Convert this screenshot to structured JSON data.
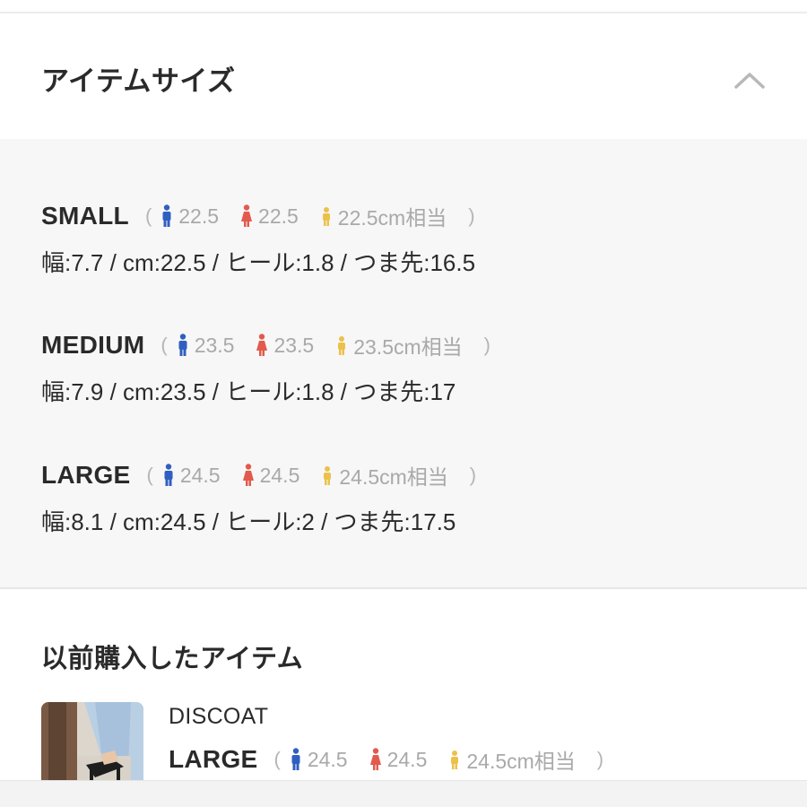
{
  "header": {
    "title": "アイテムサイズ",
    "collapse_icon": "chevron-up-icon"
  },
  "equivalence_labels": {
    "open_paren": "(",
    "close_paren": ")"
  },
  "icons": {
    "men": {
      "name": "man-icon",
      "color": "#2f5fbf"
    },
    "women": {
      "name": "woman-icon",
      "color": "#e25a4e"
    },
    "kids": {
      "name": "child-icon",
      "color": "#ecc14a"
    }
  },
  "sizes": [
    {
      "name": "SMALL",
      "men": "22.5",
      "women": "22.5",
      "kids": "22.5cm相当",
      "detail": "幅:7.7 / cm:22.5 / ヒール:1.8 / つま先:16.5"
    },
    {
      "name": "MEDIUM",
      "men": "23.5",
      "women": "23.5",
      "kids": "23.5cm相当",
      "detail": "幅:7.9 / cm:23.5 / ヒール:1.8 / つま先:17"
    },
    {
      "name": "LARGE",
      "men": "24.5",
      "women": "24.5",
      "kids": "24.5cm相当",
      "detail": "幅:8.1 / cm:24.5 / ヒール:2 / つま先:17.5"
    }
  ],
  "previous": {
    "title": "以前購入したアイテム",
    "item": {
      "brand": "DISCOAT",
      "size": "LARGE",
      "men": "24.5",
      "women": "24.5",
      "kids": "24.5cm相当"
    }
  }
}
